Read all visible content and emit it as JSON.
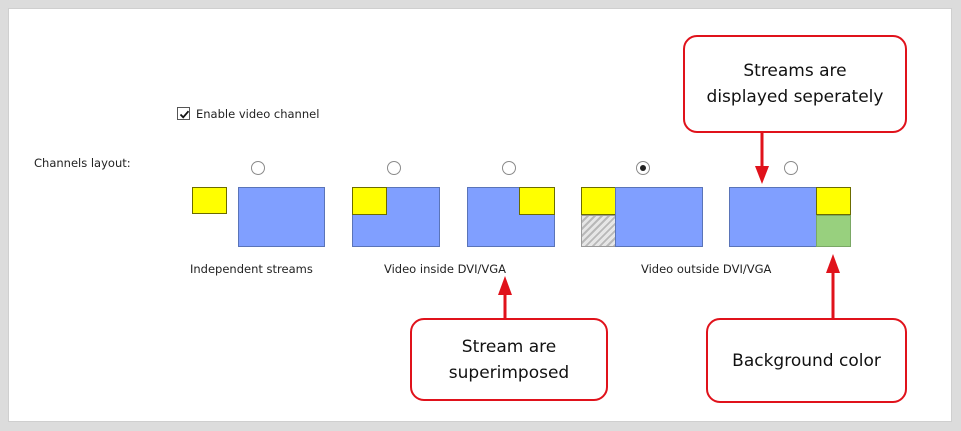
{
  "settings": {
    "enable_video_channel_label": "Enable video channel",
    "enable_video_channel_checked": true,
    "channels_layout_label": "Channels layout:"
  },
  "layouts": [
    {
      "id": "independent",
      "selected": false
    },
    {
      "id": "inside-top-left",
      "selected": false
    },
    {
      "id": "inside-top-right",
      "selected": false
    },
    {
      "id": "outside-left",
      "selected": true
    },
    {
      "id": "outside-right",
      "selected": false
    }
  ],
  "group_labels": {
    "independent": "Independent streams",
    "inside": "Video inside DVI/VGA",
    "outside": "Video outside DVI/VGA"
  },
  "callouts": {
    "separate": "Streams are\ndisplayed seperately",
    "superimposed": "Stream are\nsuperimposed",
    "background": "Background color"
  },
  "colors": {
    "video_blue": "#809fff",
    "stream_yellow": "#ffff00",
    "background_green": "#98d07e",
    "callout_red": "#e0121b"
  }
}
